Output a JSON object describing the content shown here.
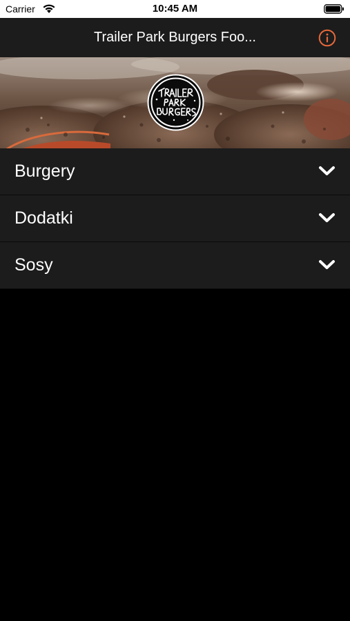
{
  "status_bar": {
    "carrier": "Carrier",
    "time": "10:45 AM"
  },
  "nav": {
    "title": "Trailer Park Burgers Foo...",
    "info_icon": "info-circle-icon",
    "accent_color": "#e8683a"
  },
  "hero": {
    "logo_text": "Trailer Park Burgers"
  },
  "categories": [
    {
      "label": "Burgery",
      "icon": "chevron-down-icon"
    },
    {
      "label": "Dodatki",
      "icon": "chevron-down-icon"
    },
    {
      "label": "Sosy",
      "icon": "chevron-down-icon"
    }
  ]
}
